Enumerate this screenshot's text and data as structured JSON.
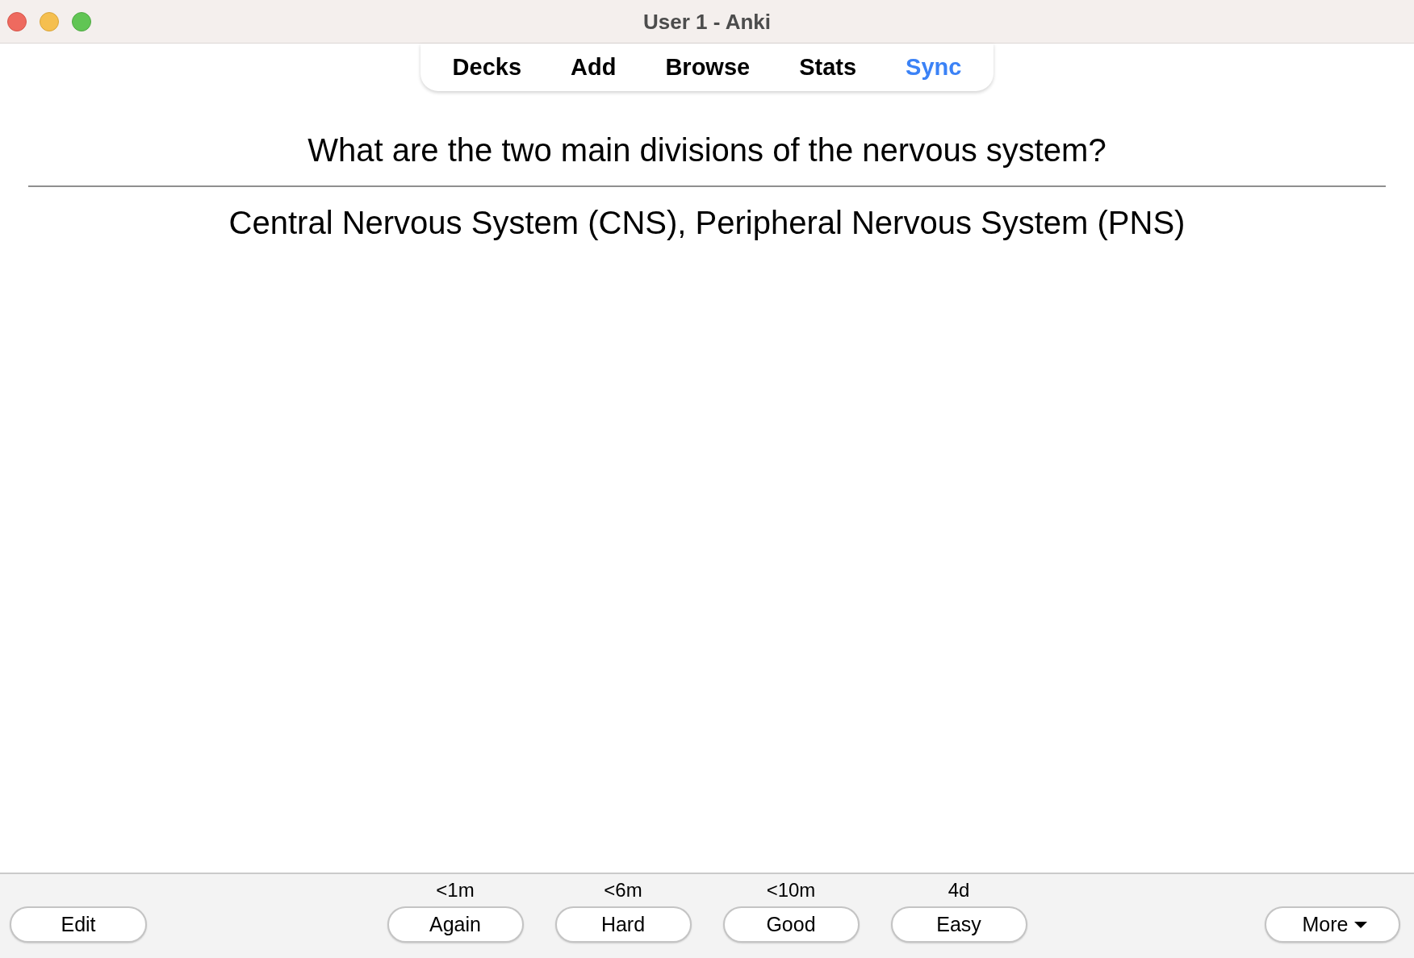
{
  "window": {
    "title": "User 1 - Anki"
  },
  "toolbar": [
    {
      "label": "Decks",
      "highlighted": false
    },
    {
      "label": "Add",
      "highlighted": false
    },
    {
      "label": "Browse",
      "highlighted": false
    },
    {
      "label": "Stats",
      "highlighted": false
    },
    {
      "label": "Sync",
      "highlighted": true
    }
  ],
  "card": {
    "question": "What are the two main divisions of the nervous system?",
    "answer": "Central Nervous System (CNS), Peripheral Nervous System (PNS)"
  },
  "bottom_bar": {
    "edit_button": "Edit",
    "answer_buttons": [
      {
        "interval": "<1m",
        "label": "Again"
      },
      {
        "interval": "<6m",
        "label": "Hard"
      },
      {
        "interval": "<10m",
        "label": "Good"
      },
      {
        "interval": "4d",
        "label": "Easy"
      }
    ],
    "more_button": "More"
  }
}
